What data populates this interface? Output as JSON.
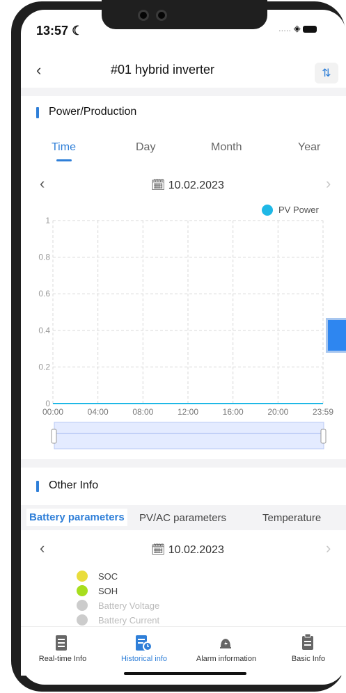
{
  "status": {
    "time": "13:57",
    "moon_icon": "moon-icon",
    "signal": ".....",
    "wifi_icon": "wifi-icon",
    "battery_icon": "battery-icon"
  },
  "header": {
    "title": "#01 hybrid inverter",
    "back_icon": "chevron-left-icon",
    "filter_icon": "filter-settings-icon"
  },
  "power_section": {
    "title": "Power/Production",
    "tabs": [
      "Time",
      "Day",
      "Month",
      "Year"
    ],
    "active_tab": "Time",
    "date": "10.02.2023"
  },
  "other_section": {
    "title": "Other Info",
    "tabs": [
      "Battery parameters",
      "PV/AC parameters",
      "Temperature"
    ],
    "active_tab": "Battery parameters",
    "date": "10.02.2023",
    "legend": [
      {
        "label": "SOC",
        "color": "#e9dd3c",
        "active": true
      },
      {
        "label": "SOH",
        "color": "#a7de1e",
        "active": true
      },
      {
        "label": "Battery Voltage",
        "color": "#cccccc",
        "active": false
      },
      {
        "label": "Battery Current",
        "color": "#cccccc",
        "active": false
      }
    ]
  },
  "chart_data": {
    "type": "line",
    "title": "",
    "xlabel": "",
    "ylabel": "",
    "x_ticks": [
      "00:00",
      "04:00",
      "08:00",
      "12:00",
      "16:00",
      "20:00",
      "23:59"
    ],
    "y_ticks": [
      "0",
      "0.2",
      "0.4",
      "0.6",
      "0.8",
      "1"
    ],
    "ylim": [
      0,
      1
    ],
    "legend": "top-right",
    "grid": true,
    "series": [
      {
        "name": "PV Power",
        "color": "#1fb8e6",
        "x": [
          "00:00",
          "23:59"
        ],
        "values": [
          0,
          0
        ]
      }
    ]
  },
  "bottom_nav": [
    {
      "label": "Real-time Info",
      "icon": "realtime-info-icon",
      "active": false
    },
    {
      "label": "Historical info",
      "icon": "historical-info-icon",
      "active": true
    },
    {
      "label": "Alarm information",
      "icon": "alarm-bell-icon",
      "active": false
    },
    {
      "label": "Basic Info",
      "icon": "clipboard-icon",
      "active": false
    }
  ]
}
